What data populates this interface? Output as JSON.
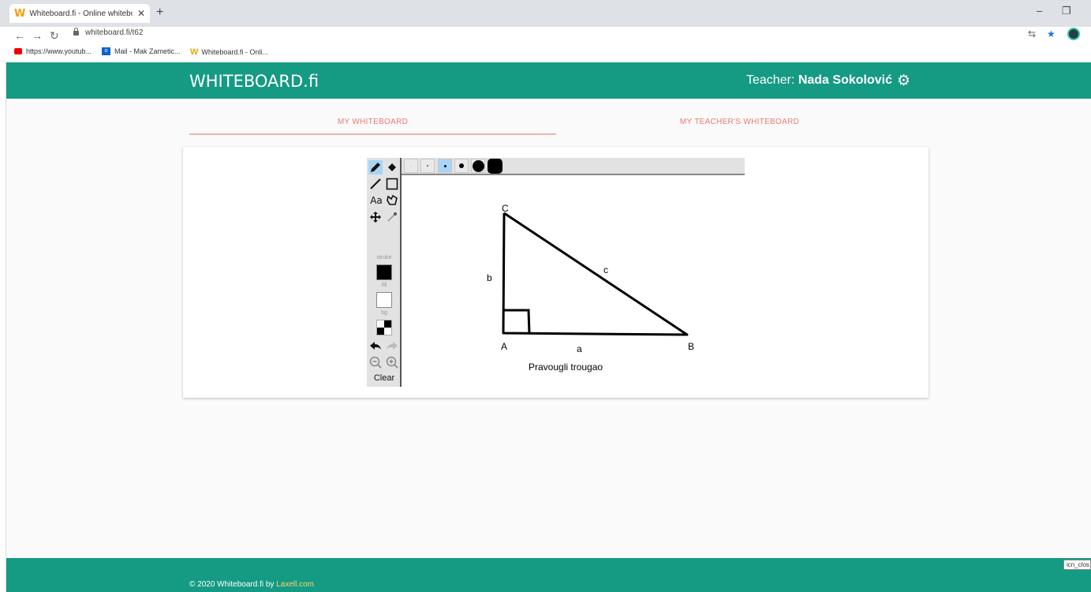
{
  "browser": {
    "tab_title": "Whiteboard.fi - Online whitebo",
    "tab_icon": "W",
    "tab_close": "✕",
    "new_tab": "+",
    "url": "whiteboard.fi/t62",
    "bookmarks": [
      {
        "label": "https://www.youtub...",
        "icon": "youtube-icon"
      },
      {
        "label": "Mail - Mak Zametic...",
        "icon": "outlook-icon",
        "icon_text": "o"
      },
      {
        "label": "Whiteboard.fi - Onli...",
        "icon": "whiteboard-icon",
        "icon_text": "W"
      }
    ]
  },
  "header": {
    "brand": "WHITEBOARD.fi",
    "teacher_prefix": "Teacher:",
    "teacher_name": "Nada Sokolović"
  },
  "tabs": {
    "mine": "MY WHITEBOARD",
    "teacher": "MY TEACHER'S WHITEBOARD"
  },
  "whiteboard": {
    "tools": [
      {
        "name": "pencil-tool",
        "icon": "pencil-icon",
        "selected": true
      },
      {
        "name": "eraser-tool",
        "icon": "eraser-icon",
        "selected": false
      },
      {
        "name": "line-tool",
        "icon": "line-icon",
        "selected": false
      },
      {
        "name": "rectangle-tool",
        "icon": "rectangle-icon",
        "selected": false
      },
      {
        "name": "text-tool",
        "icon": "text-icon",
        "label": "Aa",
        "selected": false
      },
      {
        "name": "lasso-tool",
        "icon": "lasso-icon",
        "selected": false
      },
      {
        "name": "move-tool",
        "icon": "move-icon",
        "selected": false
      },
      {
        "name": "eyedropper-tool",
        "icon": "eyedropper-icon",
        "selected": false
      }
    ],
    "stroke_label": "stroke",
    "fill_label": "fill",
    "bg_label": "bg",
    "stroke_color": "#000000",
    "fill_color": "#ffffff",
    "clear_label": "Clear",
    "sizes_selected_index": 2,
    "drawing": {
      "vertex_labels": {
        "a_vertex": "A",
        "b_vertex": "B",
        "c_vertex": "C"
      },
      "side_labels": {
        "side_a": "a",
        "side_b": "b",
        "side_c": "c"
      },
      "caption": "Pravougli trougao"
    }
  },
  "footer": {
    "copyright": "© 2020 Whiteboard.fi by ",
    "link": "Laxell.com"
  },
  "tooltip": "icn_clos",
  "colors": {
    "brand_green": "#159a83",
    "tab_accent": "#e97b70",
    "selected_tool": "#a8d4f5",
    "footer_link": "#f5d76e"
  }
}
